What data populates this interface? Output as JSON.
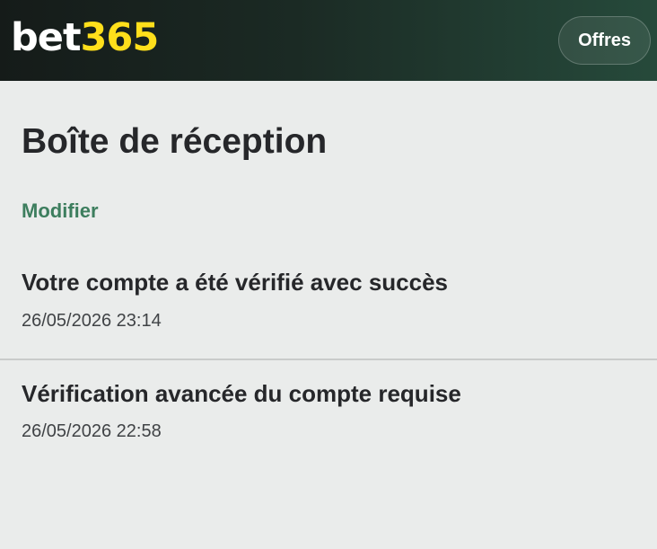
{
  "header": {
    "logo_part1": "bet",
    "logo_part2": "365",
    "offers_label": "Offres",
    "brand_colors": {
      "logo_white": "#ffffff",
      "logo_yellow": "#ffdf1b",
      "accent_green": "#3d7e5e"
    }
  },
  "main": {
    "title": "Boîte de réception",
    "edit_label": "Modifier",
    "messages": [
      {
        "title": "Votre compte a été vérifié avec succès",
        "date": "26/05/2026 23:14"
      },
      {
        "title": "Vérification avancée du compte requise",
        "date": "26/05/2026 22:58"
      }
    ]
  }
}
